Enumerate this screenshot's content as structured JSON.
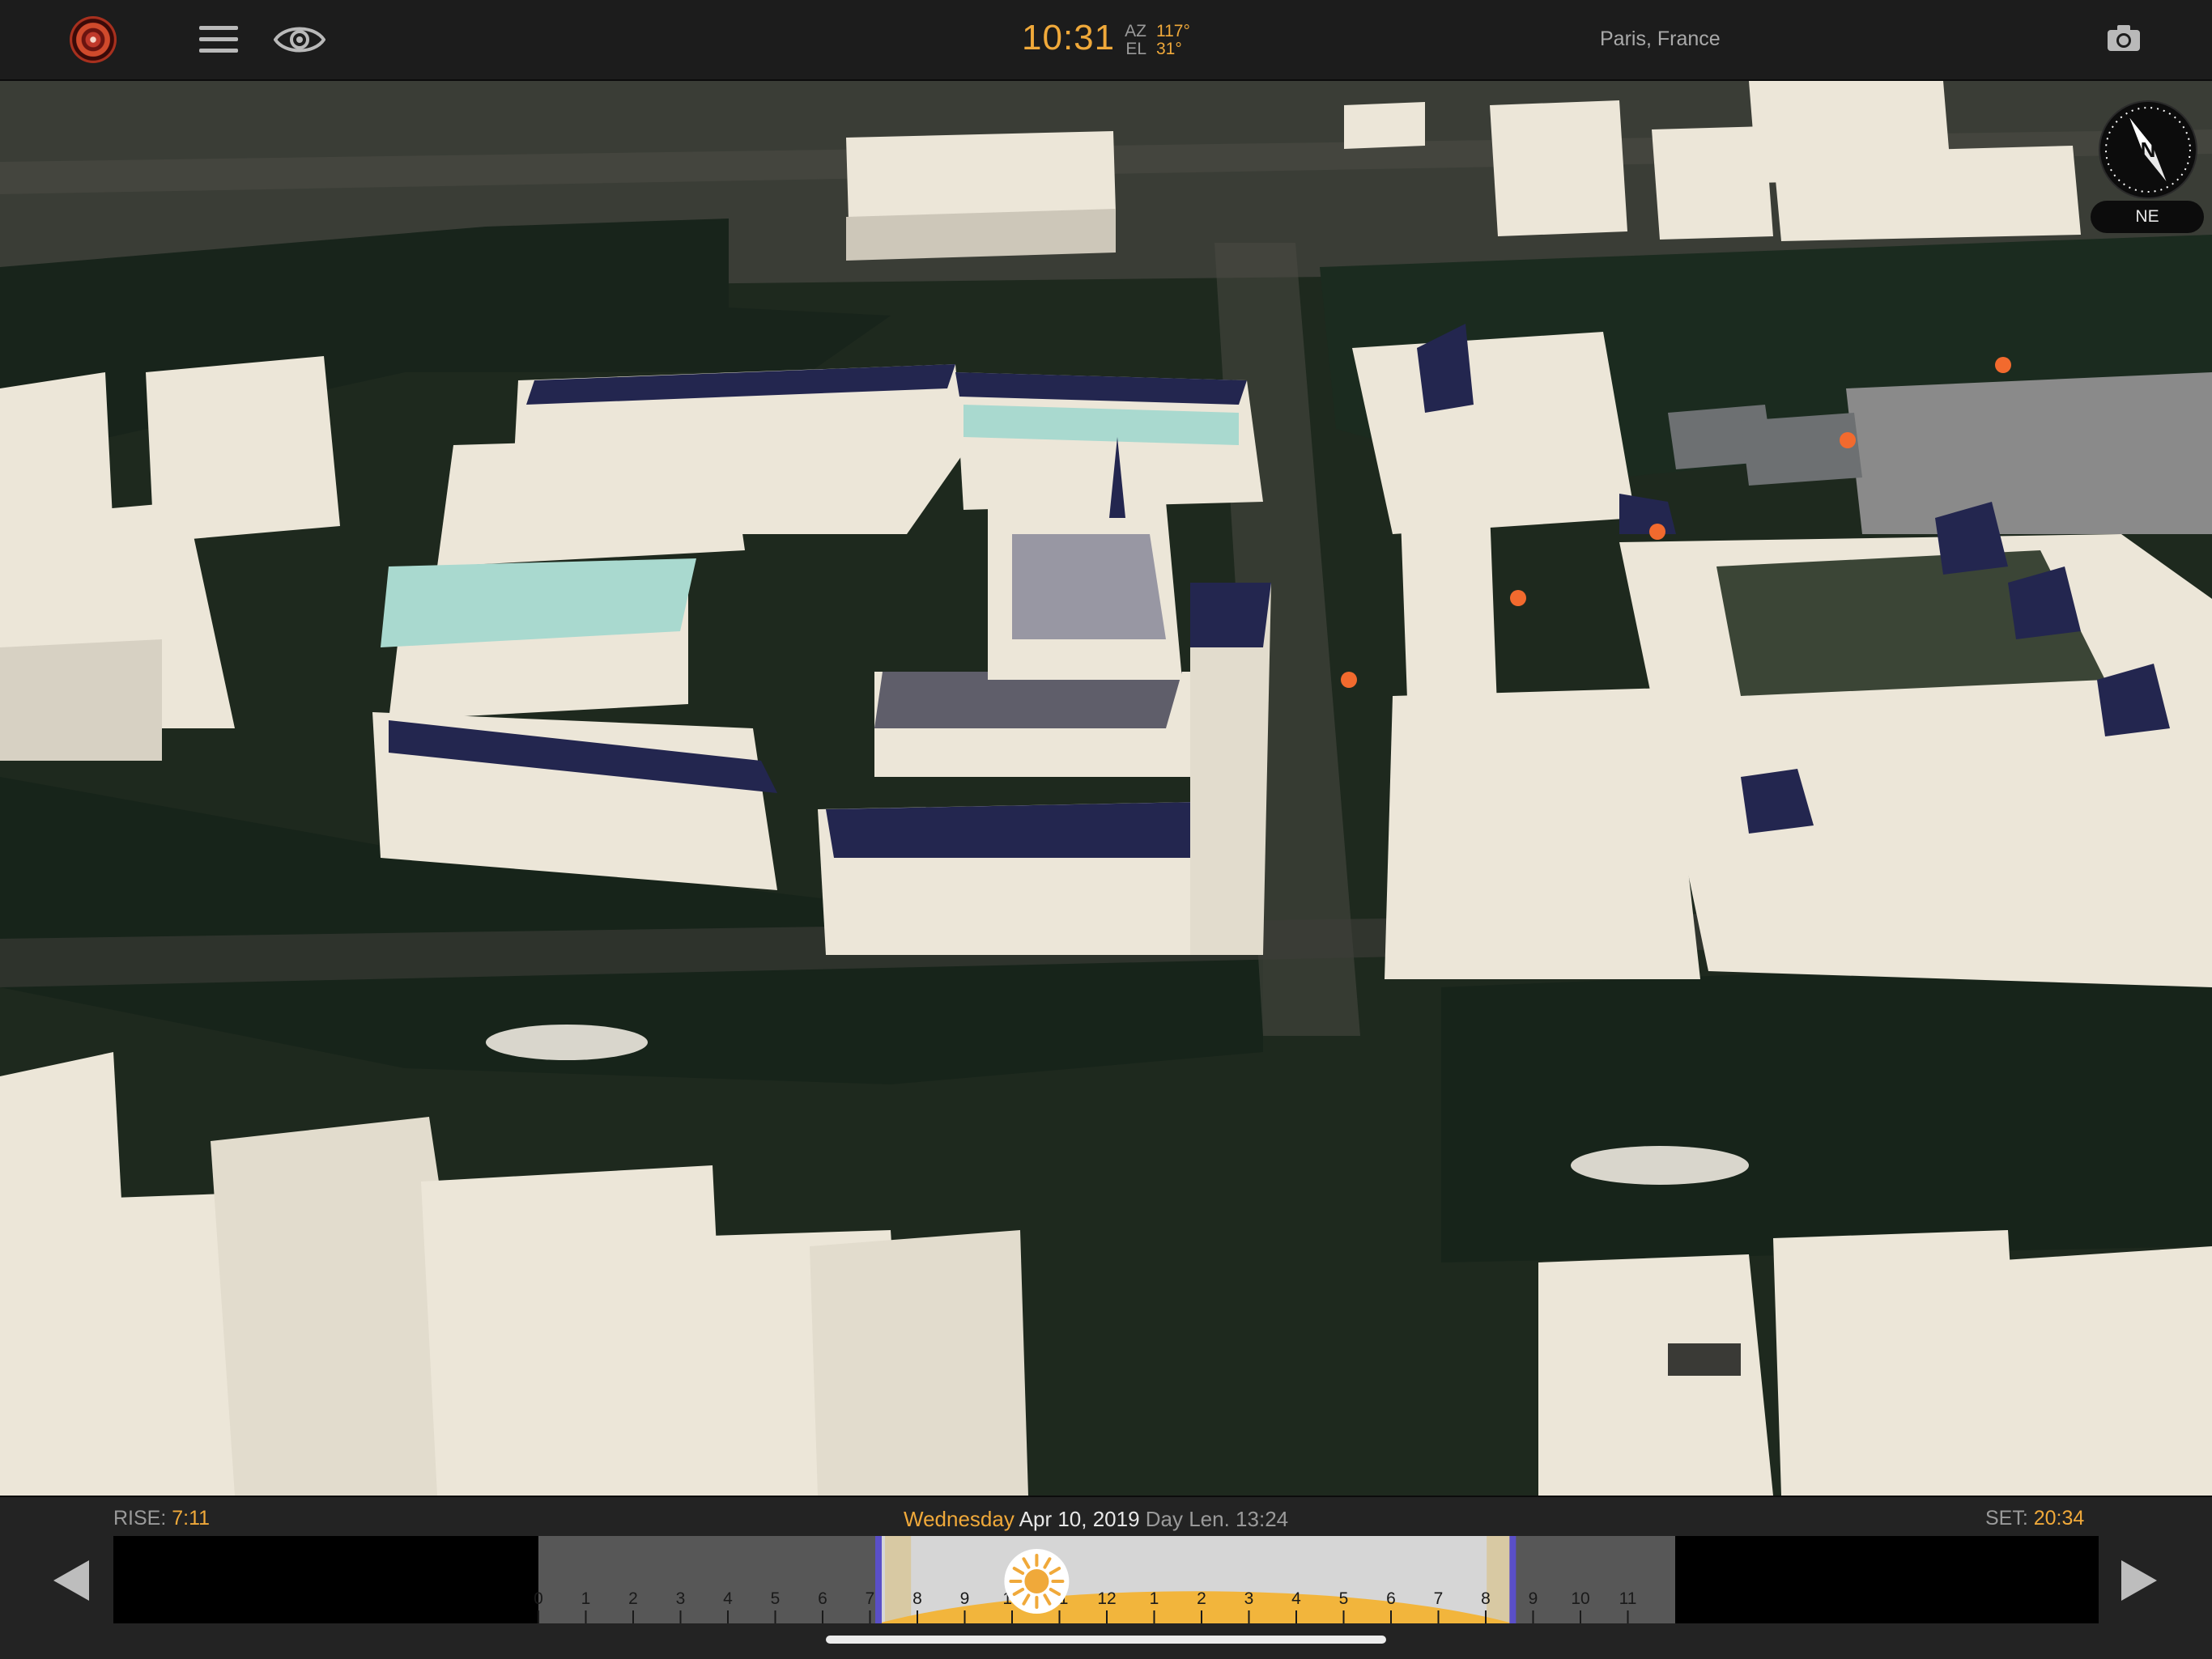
{
  "header": {
    "time": "10:31",
    "az_label": "AZ",
    "az_value": "117°",
    "el_label": "EL",
    "el_value": "31°",
    "location": "Paris, France"
  },
  "compass": {
    "heading": "NE",
    "north_label": "N"
  },
  "timeline": {
    "rise_label": "RISE:",
    "rise_time": "7:11",
    "weekday": "Wednesday",
    "date": "Apr 10, 2019",
    "day_length": "Day Len. 13:24",
    "set_label": "SET:",
    "set_time": "20:34",
    "hours": [
      "0",
      "1",
      "2",
      "3",
      "4",
      "5",
      "6",
      "7",
      "8",
      "9",
      "10",
      "11",
      "12",
      "1",
      "2",
      "3",
      "4",
      "5",
      "6",
      "7",
      "8",
      "9",
      "10",
      "11"
    ],
    "current_hour": 10.52,
    "sunrise_hour": 7.18,
    "sunset_hour": 20.57
  },
  "colors": {
    "accent": "#f0a93a",
    "building": "#ece6d8",
    "roof": "#23264f",
    "marker": "#f26a2e"
  },
  "icons": [
    "app-logo-icon",
    "menu-icon",
    "eye-icon",
    "camera-icon",
    "compass-icon",
    "sun-icon",
    "prev-arrow-icon",
    "next-arrow-icon"
  ]
}
